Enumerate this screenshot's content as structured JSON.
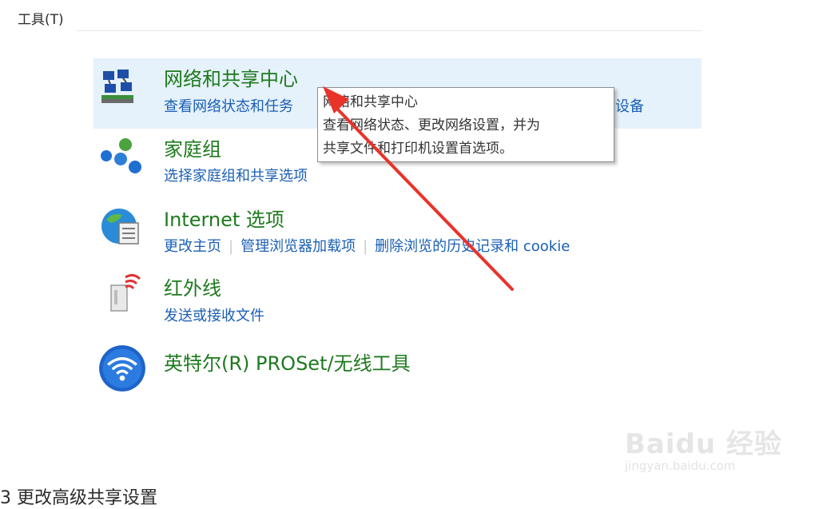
{
  "menu": {
    "tools_label": "工具(T)"
  },
  "items": [
    {
      "title": "网络和共享中心",
      "icon": "network-sharing-icon",
      "links": [
        "查看网络状态和任务",
        "设备"
      ]
    },
    {
      "title": "家庭组",
      "icon": "homegroup-icon",
      "links": [
        "选择家庭组和共享选项"
      ]
    },
    {
      "title": "Internet 选项",
      "icon": "internet-options-icon",
      "links": [
        "更改主页",
        "管理浏览器加载项",
        "删除浏览的历史记录和 cookie"
      ]
    },
    {
      "title": "红外线",
      "icon": "infrared-icon",
      "links": [
        "发送或接收文件"
      ]
    },
    {
      "title": "英特尔(R) PROSet/无线工具",
      "icon": "intel-wireless-icon",
      "links": []
    }
  ],
  "tooltip": {
    "line1": "网络和共享中心",
    "line2": "查看网络状态、更改网络设置，并为",
    "line3": "共享文件和打印机设置首选项。"
  },
  "watermark": {
    "brand": "Baidu 经验",
    "url": "jingyan.baidu.com"
  },
  "bottom_text": "3 更改高级共享设置",
  "colors": {
    "title_green": "#1e7a1e",
    "link_blue": "#1a5fb4",
    "selected_bg": "#e5f1fb",
    "arrow_red": "#e8332a"
  }
}
